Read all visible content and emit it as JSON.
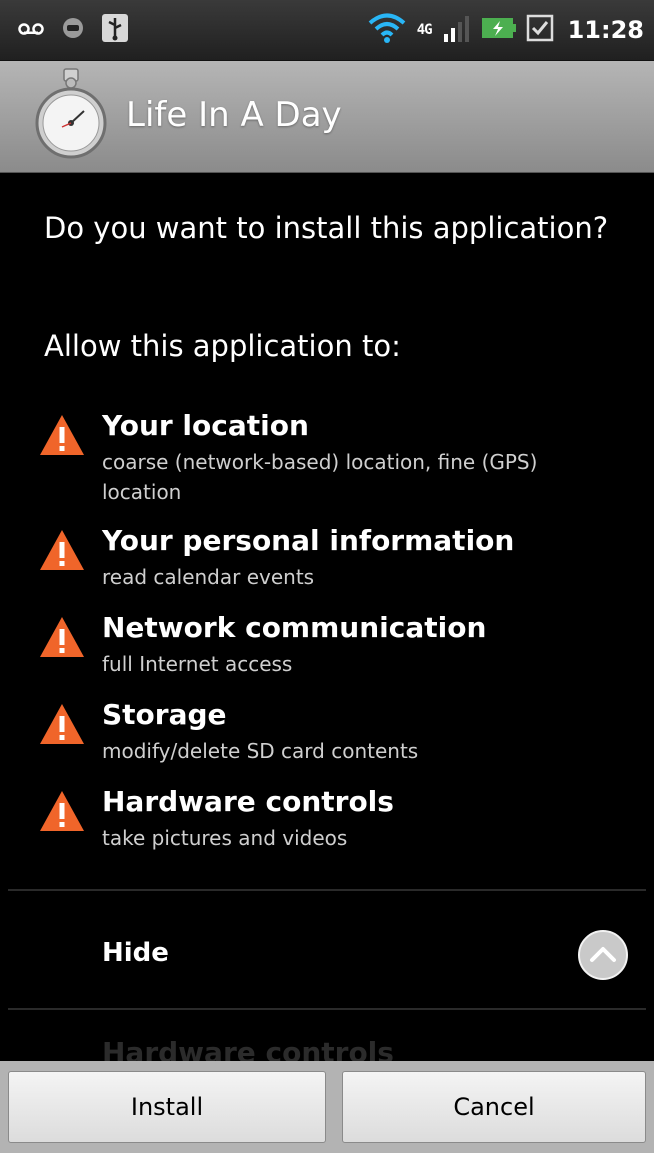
{
  "status_bar": {
    "time": "11:28",
    "network_label": "4G",
    "icons": [
      "voicemail-icon",
      "notification-dot-icon",
      "usb-icon",
      "wifi-icon",
      "signal-icon",
      "battery-charging-icon",
      "checkbox-icon"
    ]
  },
  "app": {
    "title": "Life In A Day",
    "icon": "stopwatch-icon"
  },
  "main": {
    "question": "Do you want to install this application?",
    "allow_heading": "Allow this application to:",
    "permissions": [
      {
        "title": "Your location",
        "description": "coarse (network-based) location, fine (GPS) location"
      },
      {
        "title": "Your personal information",
        "description": "read calendar events"
      },
      {
        "title": "Network communication",
        "description": "full Internet access"
      },
      {
        "title": "Storage",
        "description": "modify/delete SD card contents"
      },
      {
        "title": "Hardware controls",
        "description": "take pictures and videos"
      }
    ],
    "hide_label": "Hide",
    "ghost_text": "Hardware controls"
  },
  "buttons": {
    "install": "Install",
    "cancel": "Cancel"
  },
  "colors": {
    "warning": "#f0652a",
    "background": "#000000",
    "titlebar": "#9e9e9e"
  }
}
